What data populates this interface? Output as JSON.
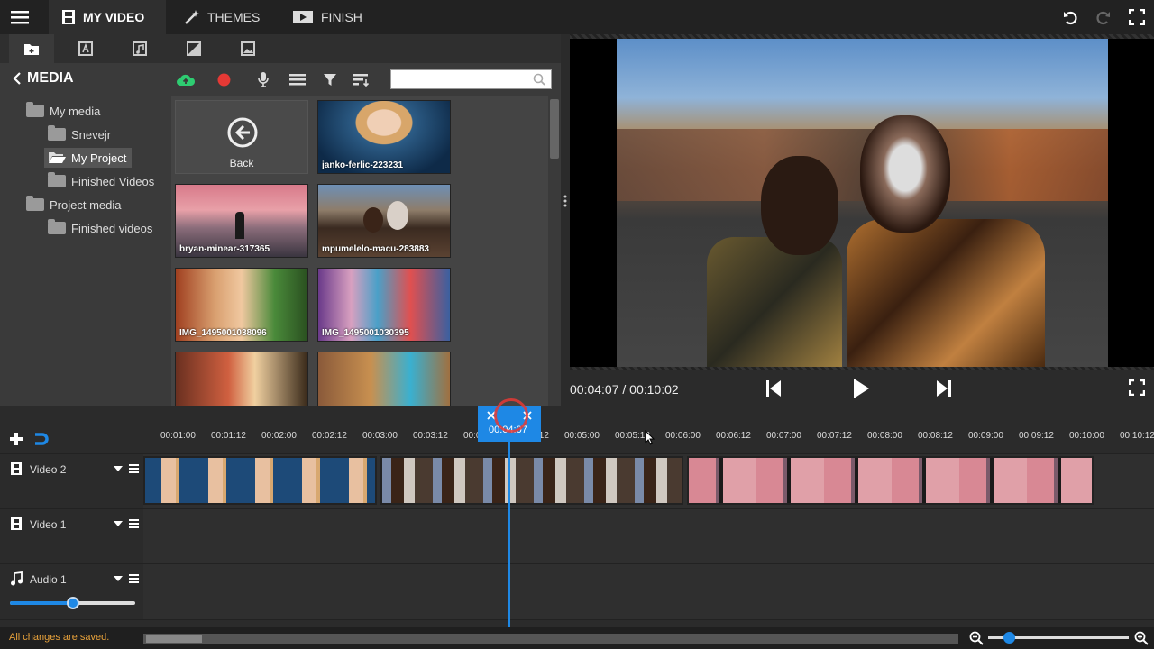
{
  "topbar": {
    "tabs": [
      {
        "label": "MY VIDEO"
      },
      {
        "label": "THEMES"
      },
      {
        "label": "FINISH"
      }
    ]
  },
  "media": {
    "title": "MEDIA",
    "search_placeholder": ""
  },
  "tree": {
    "items": [
      {
        "label": "My media"
      },
      {
        "label": "Snevejr"
      },
      {
        "label": "My Project"
      },
      {
        "label": "Finished Videos"
      },
      {
        "label": "Project media"
      },
      {
        "label": "Finished videos"
      }
    ]
  },
  "grid": {
    "back_label": "Back",
    "items": [
      {
        "label": "janko-ferlic-223231"
      },
      {
        "label": "bryan-minear-317365"
      },
      {
        "label": "mpumelelo-macu-283883"
      },
      {
        "label": "IMG_1495001038096"
      },
      {
        "label": "IMG_1495001030395"
      }
    ]
  },
  "player": {
    "time": "00:04:07 / 00:10:02"
  },
  "timeline": {
    "playhead_time": "00:04:07",
    "ticks": [
      "00:01:00",
      "00:01:12",
      "00:02:00",
      "00:02:12",
      "00:03:00",
      "00:03:12",
      "00:04:00",
      "00:04:12",
      "00:05:00",
      "00:05:12",
      "00:06:00",
      "00:06:12",
      "00:07:00",
      "00:07:12",
      "00:08:00",
      "00:08:12",
      "00:09:00",
      "00:09:12",
      "00:10:00",
      "00:10:12"
    ],
    "tracks": [
      {
        "label": "Video 2"
      },
      {
        "label": "Video 1"
      },
      {
        "label": "Audio 1"
      }
    ],
    "volume": 0.5,
    "zoom": 0.15
  },
  "status": {
    "message": "All changes are saved."
  },
  "colors": {
    "accent": "#1e88e5",
    "status_text": "#e8a23b",
    "record": "#e53935",
    "upload": "#2ecc71"
  }
}
